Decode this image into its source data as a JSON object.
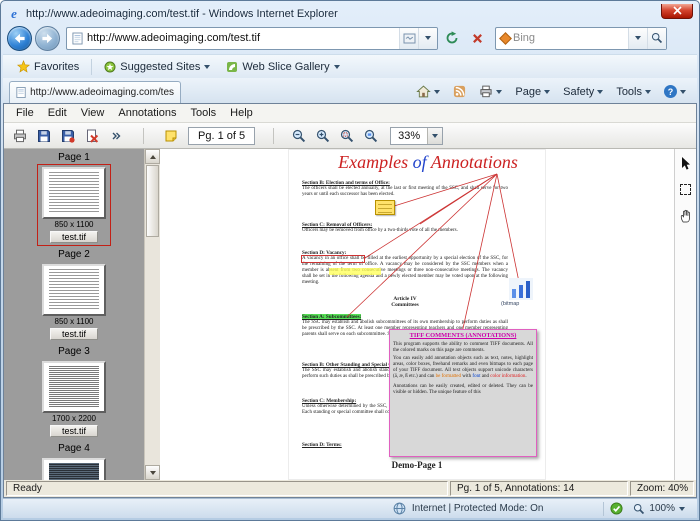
{
  "window": {
    "title": "http://www.adeoimaging.com/test.tif - Windows Internet Explorer"
  },
  "icons": {
    "ie_glyph": "e",
    "help_glyph": "?"
  },
  "nav": {
    "url": "http://www.adeoimaging.com/test.tif",
    "search_text": "Bing"
  },
  "favorites_bar": {
    "favorites_label": "Favorites",
    "suggested_sites_label": "Suggested Sites",
    "web_slice_label": "Web Slice Gallery"
  },
  "tab_bar": {
    "tab_title": "http://www.adeoimaging.com/test.tif",
    "page_label": "Page",
    "safety_label": "Safety",
    "tools_label": "Tools"
  },
  "menu": {
    "items": [
      "File",
      "Edit",
      "View",
      "Annotations",
      "Tools",
      "Help"
    ]
  },
  "toolbar": {
    "page_nav": "Pg. 1 of 5",
    "zoom_value": "33%"
  },
  "thumbnails": {
    "items": [
      {
        "label": "Page 1",
        "size": "850 x 1100",
        "file": "test.tif"
      },
      {
        "label": "Page 2",
        "size": "850 x 1100",
        "file": "test.tif"
      },
      {
        "label": "Page 3",
        "size": "1700 x 2200",
        "file": "test.tif"
      },
      {
        "label": "Page 4",
        "size": "",
        "file": ""
      }
    ]
  },
  "document": {
    "title": {
      "part1": "Examples ",
      "part2": "of",
      "part3": " Annotations"
    },
    "sections": {
      "b": {
        "heading": "Section B: Election and terms of Office:",
        "body": "The officers shall be elected annually, at the last or first meeting of the SSC, and shall serve for two years or until each successor has been elected."
      },
      "c": {
        "heading": "Section C: Removal of Officers:",
        "body": "Officers may be removed from office by a two-thirds vote of all the members."
      },
      "d": {
        "heading": "Section D: Vacancy:",
        "body": "A vacancy in an office shall be filled at the earliest opportunity by a special election of the SSC, for the remaining of the term of office. A vacancy may be considered by the SSC members when a member is absent from two consecutive meetings or three non-consecutive meetings. The vacancy shall be set in the following agenda and a newly elected member may be voted upon at the following meeting."
      },
      "article": {
        "line1": "Article IV",
        "line2": "Committees"
      },
      "a2": {
        "heading": "Section A: Subcommittees:",
        "body": "The SSC may establish and abolish subcommittees of its own membership to perform duties as shall be prescribed by the SSC. At least one member representing teachers and one member representing parents shall serve on each subcommittee. Subcommittee members shall be appointed by the SSC."
      },
      "b2": {
        "heading": "Section B: Other Standing and Special Committees:",
        "body": "The SSC may establish and abolish standing or special committees with such composition and to perform such duties as shall be prescribed by the SSC."
      },
      "c2": {
        "heading": "Section C: Membership:",
        "body": "Unless otherwise determined by the SSC, the chairperson shall appoint members of the committees. Each standing or special committee shall consist of at least one member of the SSC."
      },
      "d2": {
        "heading": "Section D: Terms:"
      }
    },
    "bitmap_label": "(bitmap",
    "comment_box": {
      "title": "TIFF COMMENTS (ANNOTATIONS)",
      "p1": "This program supports the ability to comment TIFF documents. All the colored marks on this page are comments.",
      "p2": "You can easily add annotation objects such as text, notes, highlight areas, color boxes, freehand remarks and even bitmaps to each page of your TIFF document. All text objects support unicode characters (ä, æ, ß etc.) and can ",
      "fmt1": "be formatted",
      "fmt2": " with ",
      "fmt3": "font",
      "fmt4": " and ",
      "fmt5": "color information",
      "fmt6": ".",
      "p3": "Annotations can be easily created, edited or deleted. They can be visible or hidden. The unique feature of this"
    },
    "footer": "Demo-Page 1"
  },
  "viewer_status": {
    "ready": "Ready",
    "page_info": "Pg. 1 of 5,  Annotations: 14",
    "zoom": "Zoom: 40%"
  },
  "ie_status": {
    "zone": "Internet | Protected Mode: On",
    "zoom": "100%"
  },
  "colors": {
    "title_red": "#cc2222",
    "title_blue": "#2244cc",
    "highlight_green": "#55e055",
    "comment_magenta": "#cc00aa",
    "annotation_red": "#cc3333"
  }
}
